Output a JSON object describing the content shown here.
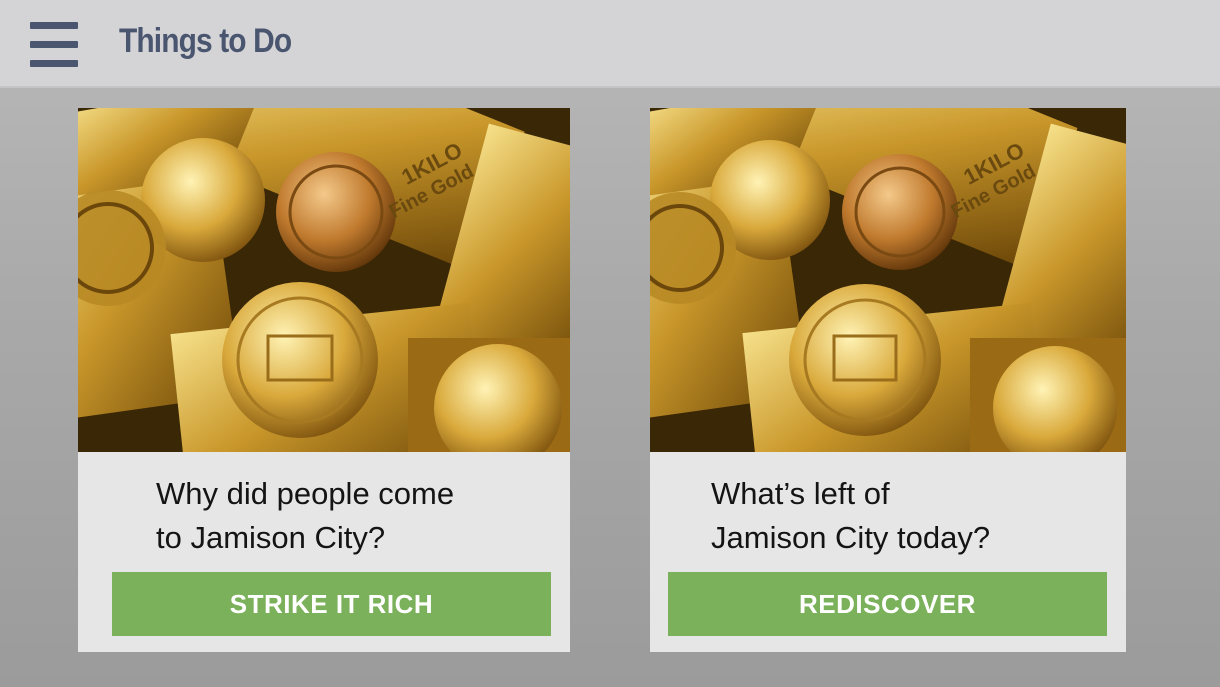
{
  "header": {
    "menu_icon": "hamburger-menu-icon",
    "title": "Things to Do"
  },
  "cards": [
    {
      "image": "gold-bars-and-coins-photo",
      "question": "Why did people come to Jamison City?",
      "question_line1": "Why did people come",
      "question_line2": "to Jamison City?",
      "button_label": "STRIKE IT RICH"
    },
    {
      "image": "gold-bars-and-coins-photo",
      "question": "What’s left of Jamison City today?",
      "question_line1": "What’s left of",
      "question_line2": "Jamison City today?",
      "button_label": "REDISCOVER"
    }
  ],
  "colors": {
    "header_bg": "#d4d4d6",
    "title_text": "#4a5670",
    "button_green": "#7ab15a",
    "card_bg": "#e6e6e6"
  }
}
